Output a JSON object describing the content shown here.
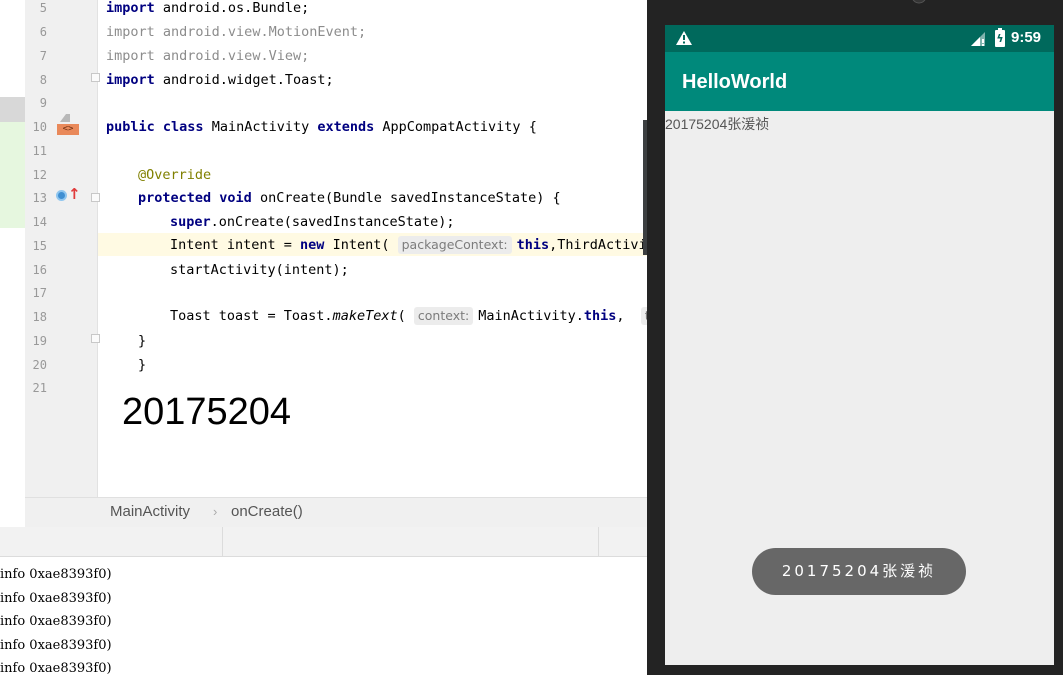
{
  "editor": {
    "line_numbers": [
      "5",
      "6",
      "7",
      "8",
      "9",
      "10",
      "11",
      "12",
      "13",
      "14",
      "15",
      "16",
      "17",
      "18",
      "19",
      "20",
      "21"
    ],
    "code": {
      "l5": {
        "kw": "import",
        "rest": " android.os.Bundle;"
      },
      "l6": {
        "kw": "import",
        "rest": " android.view.MotionEvent;"
      },
      "l7": {
        "kw": "import",
        "rest": " android.view.View;"
      },
      "l8": {
        "kw": "import",
        "rest": " android.widget.Toast;"
      },
      "l10": {
        "kw1": "public",
        "kw2": "class",
        "name": " MainActivity ",
        "kw3": "extends",
        "rest": " AppCompatActivity {"
      },
      "l12": {
        "anno": "@Override"
      },
      "l13": {
        "kw1": "protected",
        "kw2": "void",
        "rest": " onCreate(Bundle savedInstanceState) {"
      },
      "l14": {
        "kw": "super",
        "rest": ".onCreate(savedInstanceState);"
      },
      "l15": {
        "pre": "Intent intent = ",
        "kw": "new",
        "mid": " Intent(",
        "hint": "packageContext:",
        "kw2": "this",
        "rest": ",ThirdActivi"
      },
      "l16": {
        "text": "startActivity(intent);"
      },
      "l18": {
        "pre": "Toast toast = Toast.",
        "method": "makeText",
        "paren": "(",
        "hint": "context:",
        "mid": "MainActivity.",
        "kw": "this",
        "comma": ",",
        "hint2": "te"
      },
      "l19": {
        "text": "}"
      },
      "l20": {
        "text": "}"
      }
    },
    "overlay_number": "20175204"
  },
  "breadcrumb": {
    "class": "MainActivity",
    "separator": "›",
    "method": "onCreate()"
  },
  "log": {
    "lines": [
      "info 0xae8393f0)",
      "info 0xae8393f0)",
      "info 0xae8393f0)",
      "info 0xae8393f0)",
      "info 0xae8393f0)"
    ]
  },
  "emulator": {
    "status_time": "9:59",
    "app_title": "HelloWorld",
    "text_view": "20175204张湲祯",
    "toast": "20175204张湲祯",
    "colors": {
      "status_bar": "#00695c",
      "app_bar": "#00897b",
      "toast": "#676767"
    }
  },
  "icons": [
    "warning-icon",
    "signal-icon",
    "battery-icon",
    "implements-icon",
    "override-icon",
    "fold-icon"
  ]
}
